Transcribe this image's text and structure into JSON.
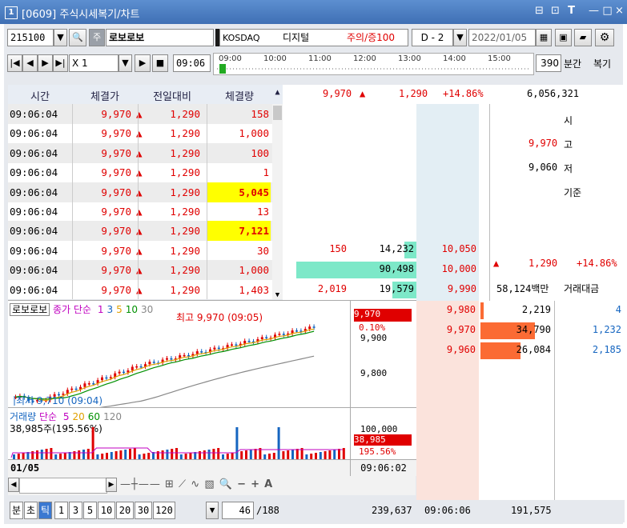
{
  "window": {
    "number": "1",
    "title": "[0609] 주식시세복기/차트",
    "controls": [
      "⊟",
      "⊡",
      "T",
      "—",
      "□",
      "×"
    ]
  },
  "toolbar1": {
    "code": "215100",
    "stock_badge": "주",
    "stock_name": "로보로보",
    "market": "KOSDAQ",
    "sector": "디지털",
    "warning": "주의/증100",
    "mode": "D - 2",
    "date": "2022/01/05"
  },
  "toolbar2": {
    "speed": "X 1",
    "time": "09:06",
    "slider_ticks": [
      "09:00",
      "10:00",
      "11:00",
      "12:00",
      "13:00",
      "14:00",
      "15:00"
    ],
    "interval_value": "390",
    "interval_unit": "분간",
    "replay_label": "복기"
  },
  "trades": {
    "headers": [
      "시간",
      "체결가",
      "전일대비",
      "체결량"
    ],
    "rows": [
      {
        "time": "09:06:04",
        "price": "9,970",
        "change": "1,290",
        "vol": "158",
        "hl": false
      },
      {
        "time": "09:06:04",
        "price": "9,970",
        "change": "1,290",
        "vol": "1,000",
        "hl": false
      },
      {
        "time": "09:06:04",
        "price": "9,970",
        "change": "1,290",
        "vol": "100",
        "hl": false
      },
      {
        "time": "09:06:04",
        "price": "9,970",
        "change": "1,290",
        "vol": "1",
        "hl": false
      },
      {
        "time": "09:06:04",
        "price": "9,970",
        "change": "1,290",
        "vol": "5,045",
        "hl": true
      },
      {
        "time": "09:06:04",
        "price": "9,970",
        "change": "1,290",
        "vol": "13",
        "hl": false
      },
      {
        "time": "09:06:04",
        "price": "9,970",
        "change": "1,290",
        "vol": "7,121",
        "hl": true
      },
      {
        "time": "09:06:04",
        "price": "9,970",
        "change": "1,290",
        "vol": "30",
        "hl": false
      },
      {
        "time": "09:06:04",
        "price": "9,970",
        "change": "1,290",
        "vol": "1,000",
        "hl": false
      },
      {
        "time": "09:06:04",
        "price": "9,970",
        "change": "1,290",
        "vol": "1,403",
        "hl": false
      }
    ]
  },
  "quote_header": {
    "price": "9,970",
    "arrow": "▲",
    "change": "1,290",
    "pct": "+14.86%",
    "volume": "6,056,321"
  },
  "info_panel": {
    "open_label": "시",
    "high_price": "9,970",
    "high_label": "고",
    "low_price": "9,060",
    "low_label": "저",
    "base_label": "기준",
    "change": "1,290",
    "pct": "+14.86%",
    "amount": "58,124백만",
    "amount_label": "거래대금"
  },
  "asks": [
    {
      "left": "150",
      "qty": "14,232",
      "price": "10,050",
      "bar": 0.1
    },
    {
      "left": "",
      "qty": "90,498",
      "price": "10,000",
      "bar": 1
    },
    {
      "left": "2,019",
      "qty": "19,579",
      "price": "9,990",
      "bar": 0.2
    }
  ],
  "bids": [
    {
      "price": "9,980",
      "qty": "2,219",
      "right": "4",
      "bar": 0.05
    },
    {
      "price": "9,970",
      "qty": "34,790",
      "right": "1,232",
      "bar": 0.85
    },
    {
      "price": "9,960",
      "qty": "26,084",
      "right": "2,185",
      "bar": 0.62
    }
  ],
  "price_chart": {
    "legend_name": "로보로보",
    "legend_ma": "종가 단순",
    "ma": [
      "1",
      "3",
      "5",
      "10",
      "30"
    ],
    "max_label": "최고 9,970 (09:05)",
    "min_label": "최저 9,710 (09:04)",
    "axis": [
      "9,900",
      "9,800"
    ],
    "cur_price": "9,970",
    "cur_pct": "0.10%"
  },
  "volume_chart": {
    "legend": "거래량",
    "legend_ma": "단순",
    "ma": [
      "5",
      "20",
      "60",
      "120"
    ],
    "value_label": "38,985주(195.56%)",
    "axis": "100,000",
    "cur_vol": "38,985",
    "cur_pct": "195.56%"
  },
  "date_axis": {
    "date": "01/05",
    "time": "09:06:02"
  },
  "bottom": {
    "buttons": [
      "분",
      "초",
      "틱",
      "1",
      "3",
      "5",
      "10",
      "20",
      "30",
      "120"
    ],
    "active": "틱",
    "page": "46",
    "total": "/188",
    "vol_a": "239,637",
    "time": "09:06:06",
    "vol_b": "191,575"
  }
}
